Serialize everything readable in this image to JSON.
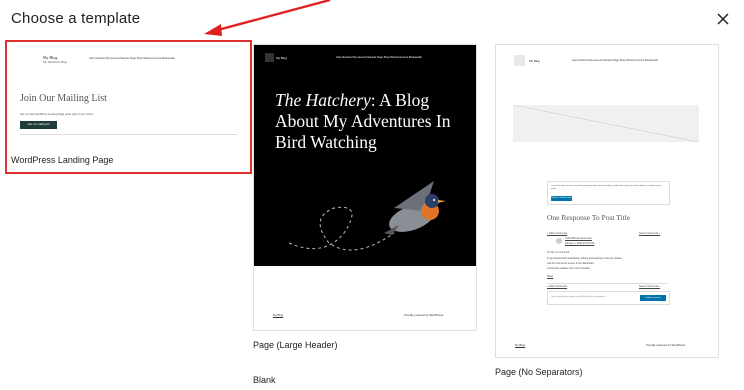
{
  "header": {
    "title": "Choose a template"
  },
  "templates": [
    {
      "label": "WordPress Landing Page",
      "preview": {
        "site_title": "My Blog",
        "site_tagline": "My WordPress Blog",
        "nav": "Cart   Checkout   My account   Sample Page   Shop   WooCommerce Bookstudio",
        "heading": "Join Our Mailing List",
        "paragraph": "Get our free WordPress Landing Page guide right to your inbox!",
        "button": "Join our mailing list"
      }
    },
    {
      "label": "Page (Large Header)",
      "preview": {
        "site_title": "My Blog",
        "nav": "Cart   Checkout   My account   Sample Page   Shop   WooCommerce Bookstudio",
        "headline_italic": "The Hatchery",
        "headline_rest": ": A Blog About My Adventures In Bird Watching",
        "footer_left": "My Blog",
        "footer_right": "Proudly powered by WordPress"
      }
    },
    {
      "label": "Page (No Separators)",
      "preview": {
        "site_title": "My Blog",
        "nav": "Cart   Checkout   My account   Sample Page   Shop   WooCommerce Bookstudio",
        "notice": "I recently came across something amazing about bird watching. Subscribe to get the latest updates straight to your inbox.",
        "notice_button": "Button to include name",
        "response_title": "One Response To Post Title",
        "comment_nav_prev": "« Older Comments",
        "comment_nav_next": "Newer Comments »",
        "commenter": "A WordPress Commenter",
        "comment_date": "January 1, 2022 at 8:00 AM",
        "comment_line1": "Hi, this is a comment.",
        "comment_line2": "To get started with moderating, editing, and deleting comments, please",
        "comment_line3": "visit the Comments screen in the dashboard.",
        "comment_line4": "Commenter avatars come from Gravatar.",
        "reply": "Reply",
        "form_placeholder": "Your comment has been saved. Be the first to comment.",
        "form_button": "Submit comment",
        "footer_left": "My Blog",
        "footer_right": "Proudly powered by WordPress"
      }
    },
    {
      "label": "Blank"
    }
  ]
}
